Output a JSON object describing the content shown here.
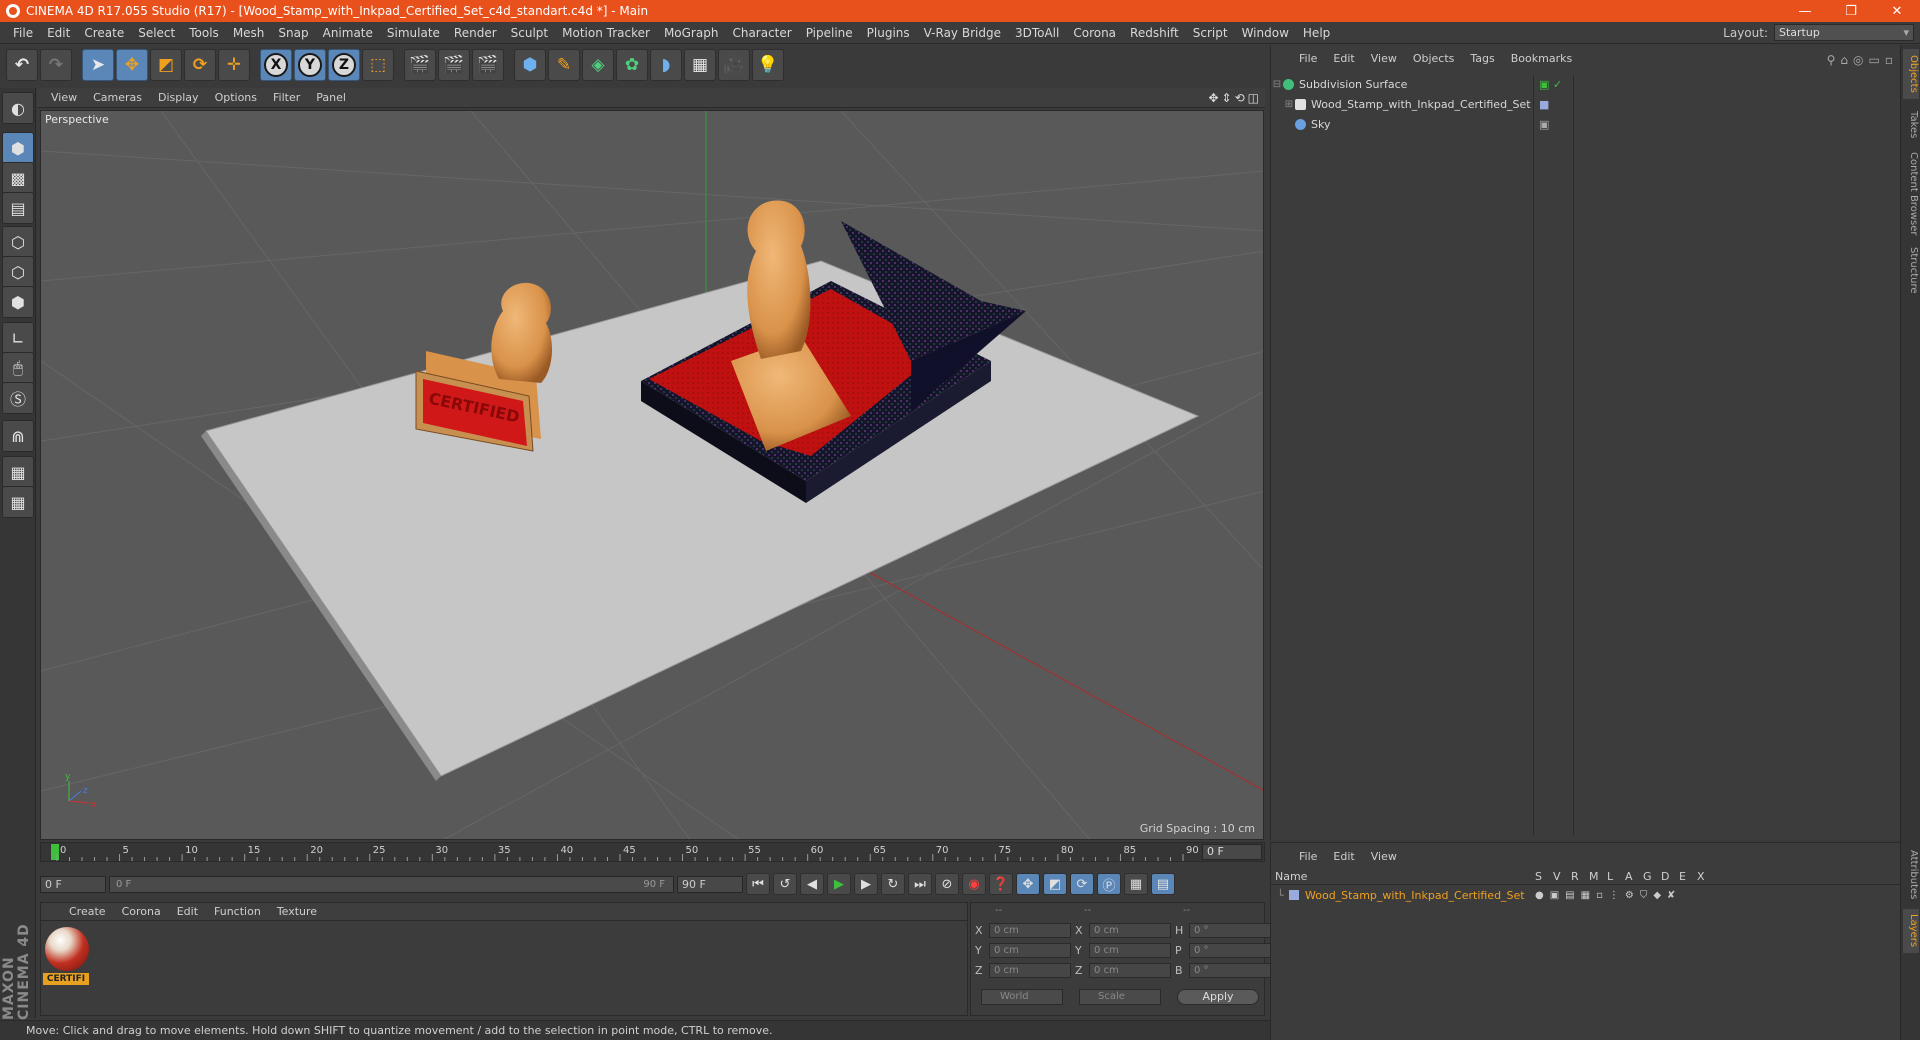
{
  "title": "CINEMA 4D R17.055 Studio (R17) - [Wood_Stamp_with_Inkpad_Certified_Set_c4d_standart.c4d *] - Main",
  "window_buttons": [
    "—",
    "❐",
    "✕"
  ],
  "menu": [
    "File",
    "Edit",
    "Create",
    "Select",
    "Tools",
    "Mesh",
    "Snap",
    "Animate",
    "Simulate",
    "Render",
    "Sculpt",
    "Motion Tracker",
    "MoGraph",
    "Character",
    "Pipeline",
    "Plugins",
    "V-Ray Bridge",
    "3DToAll",
    "Corona",
    "Redshift",
    "Script",
    "Window",
    "Help"
  ],
  "layout": {
    "label": "Layout:",
    "value": "Startup"
  },
  "viewport": {
    "menu": [
      "View",
      "Cameras",
      "Display",
      "Options",
      "Filter",
      "Panel"
    ],
    "label": "Perspective",
    "grid_spacing": "Grid Spacing : 10 cm",
    "stamp_text": "CERTIFIED"
  },
  "timeline": {
    "ticks": [
      "0",
      "5",
      "10",
      "15",
      "20",
      "25",
      "30",
      "35",
      "40",
      "45",
      "50",
      "55",
      "60",
      "65",
      "70",
      "75",
      "80",
      "85",
      "90"
    ],
    "current_frame": "0 F"
  },
  "transport": {
    "start": "0 F",
    "range_start": "0 F",
    "range_end": "90 F",
    "end": "90 F"
  },
  "material": {
    "menu": [
      "Create",
      "Corona",
      "Edit",
      "Function",
      "Texture"
    ],
    "name": "CERTIFI"
  },
  "coords": {
    "header": [
      "--",
      "--",
      "--"
    ],
    "rows": [
      {
        "a": "X",
        "av": "0 cm",
        "b": "X",
        "bv": "0 cm",
        "c": "H",
        "cv": "0 °"
      },
      {
        "a": "Y",
        "av": "0 cm",
        "b": "Y",
        "bv": "0 cm",
        "c": "P",
        "cv": "0 °"
      },
      {
        "a": "Z",
        "av": "0 cm",
        "b": "Z",
        "bv": "0 cm",
        "c": "B",
        "cv": "0 °"
      }
    ],
    "world": "World",
    "scale": "Scale",
    "apply": "Apply"
  },
  "status": "Move: Click and drag to move elements. Hold down SHIFT to quantize movement / add to the selection in point mode, CTRL to remove.",
  "objects": {
    "menu": [
      "File",
      "Edit",
      "View",
      "Objects",
      "Tags",
      "Bookmarks"
    ],
    "items": [
      {
        "name": "Subdivision Surface",
        "color": "#3fc07a"
      },
      {
        "name": "Wood_Stamp_with_Inkpad_Certified_Set",
        "color": "#e0e0e0"
      },
      {
        "name": "Sky",
        "color": "#6aa0e0"
      }
    ]
  },
  "side_tabs": [
    "Objects",
    "Takes",
    "Content Browser",
    "Structure",
    "Attributes",
    "Layers"
  ],
  "layers": {
    "menu": [
      "File",
      "Edit",
      "View"
    ],
    "columns": [
      "Name",
      "S",
      "V",
      "R",
      "M",
      "L",
      "A",
      "G",
      "D",
      "E",
      "X"
    ],
    "row_name": "Wood_Stamp_with_Inkpad_Certified_Set"
  },
  "maxon": "MAXON CINEMA 4D"
}
